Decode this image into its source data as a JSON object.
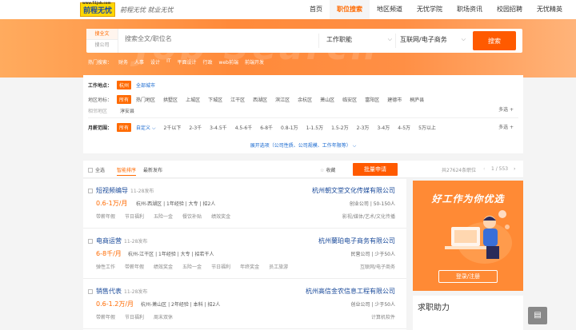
{
  "header": {
    "logo_text": "前程无忧",
    "logo_url": "www.51job.com",
    "slogan": "前程无忧 就业无忧",
    "nav": [
      {
        "label": "首页",
        "active": false
      },
      {
        "label": "职位搜索",
        "active": true
      },
      {
        "label": "地区频道",
        "active": false
      },
      {
        "label": "无忧学院",
        "active": false
      },
      {
        "label": "职场资讯",
        "active": false
      },
      {
        "label": "校园招聘",
        "active": false
      },
      {
        "label": "无忧精英",
        "active": false
      }
    ]
  },
  "search": {
    "tab_fulltext": "搜全文",
    "tab_company": "搜公司",
    "placeholder": "搜索全文/职位名",
    "function_select": "工作职能",
    "industry_select": "互联网/电子商务",
    "button": "搜索",
    "hot_label": "热门搜索：",
    "hot_items": [
      "财务",
      "人事",
      "设计",
      "IT",
      "平面设计",
      "行政",
      "web前端",
      "前端开发"
    ]
  },
  "filter": {
    "location_label": "工作地点：",
    "location_selected": "杭州",
    "location_all": "全部城市",
    "district_label": "地区地标：",
    "district_selected": "所有",
    "districts": [
      "热门地区",
      "拱墅区",
      "上城区",
      "下城区",
      "江干区",
      "西湖区",
      "滨江区",
      "余杭区",
      "萧山区",
      "临安区",
      "富阳区",
      "建德市",
      "桐庐县"
    ],
    "district_more": "多选 +",
    "district_row2_label": "相邻地区",
    "district_row2": "淳安县",
    "salary_label": "月薪范围：",
    "salary_selected": "所有",
    "salary_custom": "自定义",
    "salaries": [
      "2千以下",
      "2-3千",
      "3-4.5千",
      "4.5-6千",
      "6-8千",
      "0.8-1万",
      "1-1.5万",
      "1.5-2万",
      "2-3万",
      "3-4万",
      "4-5万",
      "5万以上"
    ],
    "salary_more": "多选 +",
    "expand_text": "展开选项（公司性质、公司规模、工作年限等）"
  },
  "list_header": {
    "select_all": "全选",
    "tab_smart": "智能排序",
    "tab_latest": "最新发布",
    "favorite": "收藏",
    "apply_button": "批量申请",
    "total": "共27624条职位",
    "page": "1 / 553"
  },
  "jobs": [
    {
      "title": "短视频编导",
      "date": "11-28发布",
      "company": "杭州朝文堂文化传媒有限公司",
      "salary": "0.6-1万/月",
      "requirements": "杭州-西湖区 | 1年经验 | 大专 | 招2人",
      "company_info": "创业公司 | 50-150人",
      "tags": [
        "带薪年假",
        "节日福利",
        "五险一金",
        "餐饮补贴",
        "绩效奖金"
      ],
      "industry": "影视/媒体/艺术/文化传播"
    },
    {
      "title": "电商运营",
      "date": "11-28发布",
      "company": "杭州蘭珀电子商务有限公司",
      "salary": "6-8千/月",
      "requirements": "杭州-江干区 | 1年经验 | 大专 | 招若干人",
      "company_info": "民营公司 | 少于50人",
      "tags": [
        "弹性工作",
        "带薪年假",
        "绩效奖金",
        "五险一金",
        "节日福利",
        "年终奖金",
        "员工旅游"
      ],
      "industry": "互联网/电子商务"
    },
    {
      "title": "销售代表",
      "date": "11-28发布",
      "company": "杭州高信金农信息工程有限公司",
      "salary": "0.6-1.2万/月",
      "requirements": "杭州-萧山区 | 2年经验 | 本科 | 招2人",
      "company_info": "创业公司 | 少于50人",
      "tags": [
        "带薪年假",
        "节日福利",
        "周末双休"
      ],
      "industry": "计算机软件"
    }
  ],
  "ad": {
    "title": "好工作为你优选",
    "button": "登录/注册"
  },
  "help": {
    "title": "求职助力"
  },
  "colors": {
    "accent": "#ff6a00",
    "link": "#1a4a9a",
    "banner": "#ff8a3a"
  }
}
